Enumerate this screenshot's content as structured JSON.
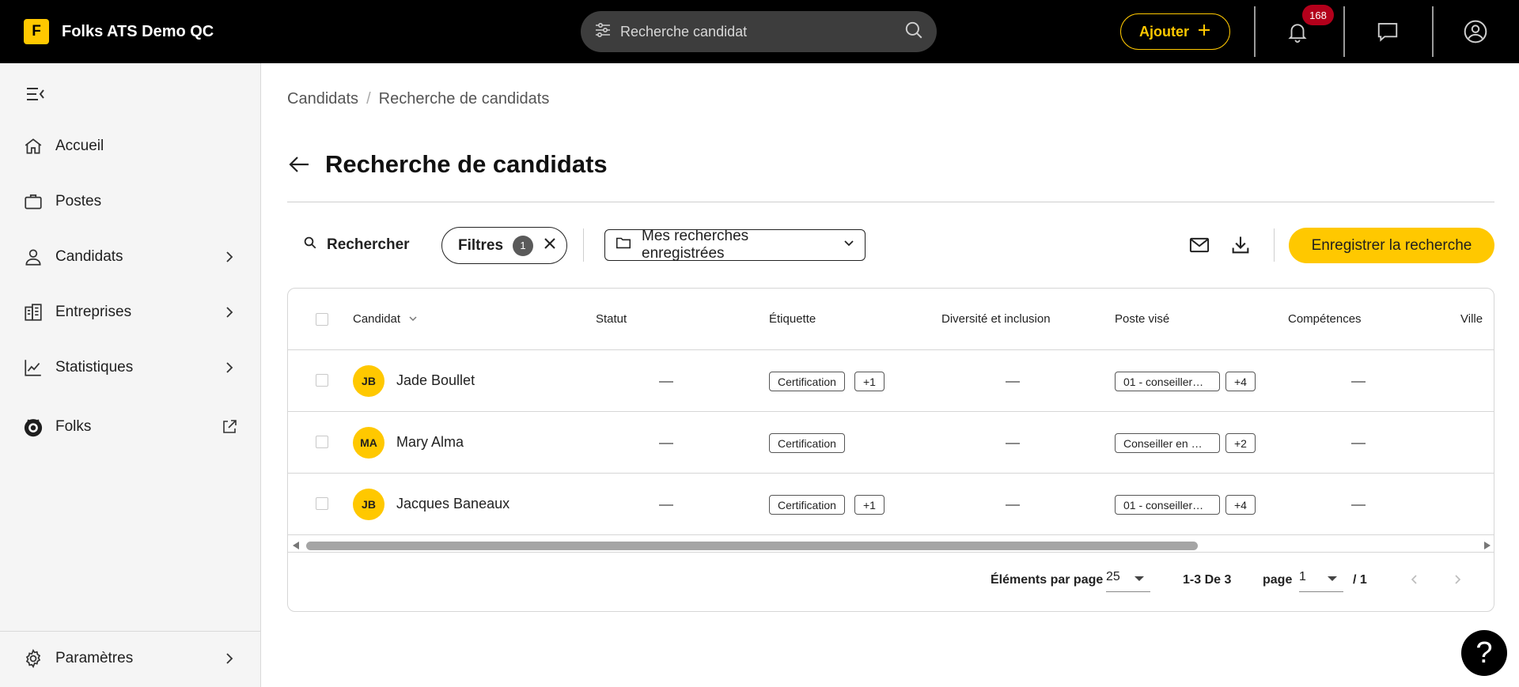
{
  "app": {
    "logo_letter": "F",
    "name": "Folks ATS Demo QC"
  },
  "topbar": {
    "search_placeholder": "Recherche candidat",
    "add_label": "Ajouter",
    "notification_count": "168"
  },
  "sidebar": {
    "items": [
      {
        "label": "Accueil",
        "icon": "home-icon"
      },
      {
        "label": "Postes",
        "icon": "briefcase-icon"
      },
      {
        "label": "Candidats",
        "icon": "person-icon"
      },
      {
        "label": "Entreprises",
        "icon": "building-icon"
      },
      {
        "label": "Statistiques",
        "icon": "chart-icon"
      },
      {
        "label": "Folks",
        "icon": "folks-logo-icon"
      }
    ],
    "settings_label": "Paramètres"
  },
  "breadcrumb": {
    "items": [
      "Candidats",
      "Recherche de candidats"
    ],
    "separator": "/"
  },
  "page": {
    "title": "Recherche de candidats"
  },
  "toolbar": {
    "search_label": "Rechercher",
    "filters_label": "Filtres",
    "filters_count": "1",
    "saved_searches_label": "Mes recherches enregistrées",
    "save_search_label": "Enregistrer la recherche"
  },
  "table": {
    "columns": [
      "Candidat",
      "Statut",
      "Étiquette",
      "Diversité et inclusion",
      "Poste visé",
      "Compétences",
      "Ville"
    ],
    "rows": [
      {
        "initials": "JB",
        "name": "Jade Boullet",
        "tag": "Certification",
        "tag_more": "+1",
        "post": "01 - conseiller…",
        "post_more": "+4"
      },
      {
        "initials": "MA",
        "name": "Mary Alma",
        "tag": "Certification",
        "tag_more": "",
        "post": "Conseiller en …",
        "post_more": "+2"
      },
      {
        "initials": "JB",
        "name": "Jacques Baneaux",
        "tag": "Certification",
        "tag_more": "+1",
        "post": "01 - conseiller…",
        "post_more": "+4"
      }
    ]
  },
  "pagination": {
    "per_page_label": "Éléments par page",
    "per_page_value": "25",
    "range_label": "1-3 De 3",
    "page_label": "page",
    "page_value": "1",
    "page_total": "/ 1"
  },
  "help": {
    "label": "?"
  },
  "colors": {
    "accent": "#ffc800",
    "topbar_bg": "#000000",
    "badge": "#b3001b"
  }
}
